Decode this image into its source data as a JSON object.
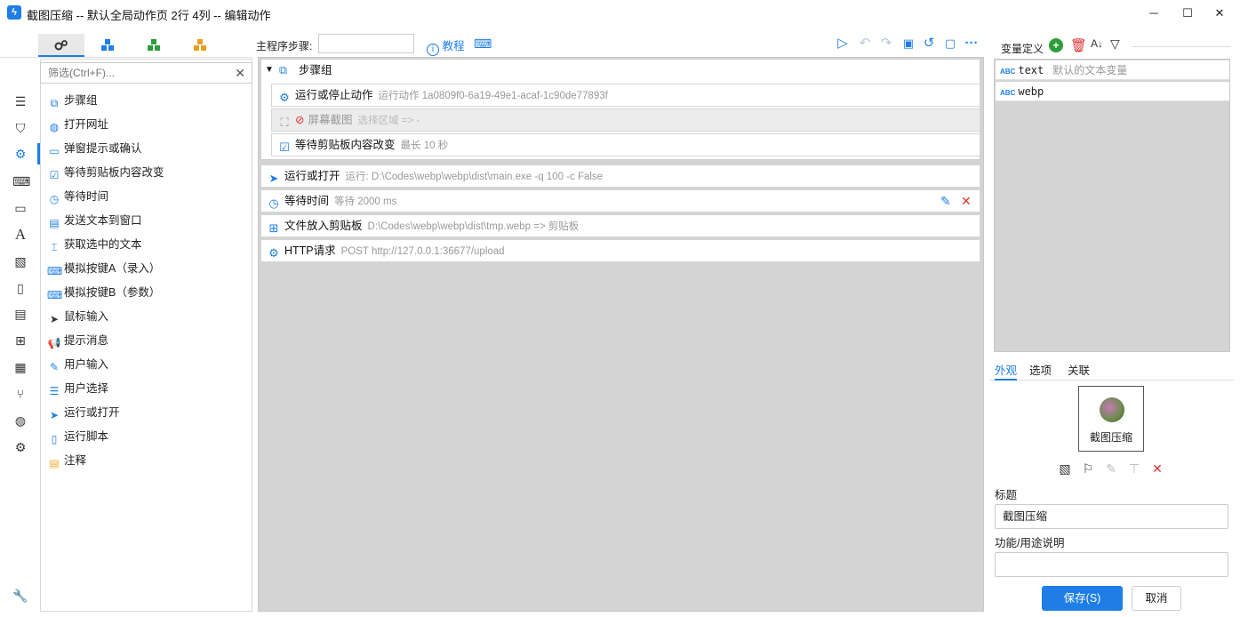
{
  "window": {
    "title": "截图压缩 -- 默认全局动作页 2行 4列 -- 编辑动作",
    "app_icon": "bolt-icon",
    "controls": [
      "minimize",
      "maximize",
      "close"
    ]
  },
  "left_tabs": [
    "gear-group-icon",
    "blue-cubes-icon",
    "green-cubes-icon",
    "orange-cubes-icon"
  ],
  "left_sidebar_icons": [
    "menu-icon",
    "bookmark-icon",
    "settings-icon",
    "keyboard-icon",
    "window-icon",
    "text-icon",
    "image-icon",
    "clipboard-icon",
    "document-icon",
    "windows-icon",
    "apps-icon",
    "branch-icon",
    "globe-icon",
    "gears-icon",
    "wrench-icon"
  ],
  "filter": {
    "placeholder": "筛选(Ctrl+F)..."
  },
  "actions": [
    {
      "label": "步骤组",
      "icon": "layers-icon"
    },
    {
      "label": "打开网址",
      "icon": "globe-icon"
    },
    {
      "label": "弹窗提示或确认",
      "icon": "dialog-icon"
    },
    {
      "label": "等待剪贴板内容改变",
      "icon": "clipboard-check-icon"
    },
    {
      "label": "等待时间",
      "icon": "timer-icon"
    },
    {
      "label": "发送文本到窗口",
      "icon": "message-icon"
    },
    {
      "label": "获取选中的文本",
      "icon": "text-cursor-icon"
    },
    {
      "label": "模拟按键A（录入）",
      "icon": "keyboard-icon"
    },
    {
      "label": "模拟按键B（参数）",
      "icon": "keyboard-icon"
    },
    {
      "label": "鼠标输入",
      "icon": "cursor-icon"
    },
    {
      "label": "提示消息",
      "icon": "megaphone-icon"
    },
    {
      "label": "用户输入",
      "icon": "user-edit-icon"
    },
    {
      "label": "用户选择",
      "icon": "list-icon"
    },
    {
      "label": "运行或打开",
      "icon": "send-icon"
    },
    {
      "label": "运行脚本",
      "icon": "script-icon"
    },
    {
      "label": "注释",
      "icon": "note-icon"
    }
  ],
  "toolbar": {
    "step_label": "主程序步骤:",
    "step_value": "",
    "tutorial_link": "教程",
    "icons": [
      "play-icon",
      "undo-icon",
      "redo-icon",
      "save-icon",
      "history-icon",
      "note-icon",
      "more-icon"
    ]
  },
  "steps": [
    {
      "label": "步骤组",
      "detail": "",
      "icon": "layers-icon",
      "type": "group"
    },
    {
      "label": "运行或停止动作",
      "detail": "运行动作 1a0809f0-6a19-49e1-acaf-1c90de77893f",
      "icon": "gear-icon",
      "type": "child"
    },
    {
      "label": "屏幕截图",
      "detail": "选择区域 => -",
      "icon": "screenshot-icon",
      "type": "child-disabled"
    },
    {
      "label": "等待剪贴板内容改变",
      "detail": "最长 10 秒",
      "icon": "clipboard-check-icon",
      "type": "child"
    },
    {
      "label": "运行或打开",
      "detail": "运行:  D:\\Codes\\webp\\webp\\dist\\main.exe -q 100 -c False",
      "icon": "send-icon",
      "type": "step"
    },
    {
      "label": "等待时间",
      "detail": "等待 2000 ms",
      "icon": "timer-icon",
      "type": "step-hover"
    },
    {
      "label": "文件放入剪贴板",
      "detail": "D:\\Codes\\webp\\webp\\dist\\tmp.webp  => 剪贴板",
      "icon": "clipboard-plus-icon",
      "type": "step"
    },
    {
      "label": "HTTP请求",
      "detail": "POST http://127.0.0.1:36677/upload",
      "icon": "gear-icon",
      "type": "step"
    }
  ],
  "variables": {
    "header": "变量定义",
    "icons": [
      "add-icon",
      "delete-icon",
      "sort-icon",
      "filter-icon"
    ],
    "items": [
      {
        "type": "ABC",
        "name": "text",
        "hint": "默认的文本变量"
      },
      {
        "type": "ABC",
        "name": "webp",
        "hint": ""
      }
    ]
  },
  "right_tabs": [
    "外观",
    "选项",
    "关联"
  ],
  "preview": {
    "label": "截图压缩"
  },
  "preview_icons": [
    "image-icon",
    "flag-icon",
    "eyedropper-icon",
    "shirt-icon",
    "remove-icon"
  ],
  "form": {
    "title_label": "标题",
    "title_value": "截图压缩",
    "desc_label": "功能/用途说明",
    "desc_value": ""
  },
  "buttons": {
    "save": "保存(S)",
    "cancel": "取消"
  },
  "colors": {
    "accent": "#1e7ee6",
    "danger": "#e03131",
    "canvas": "#d4d4d4"
  }
}
